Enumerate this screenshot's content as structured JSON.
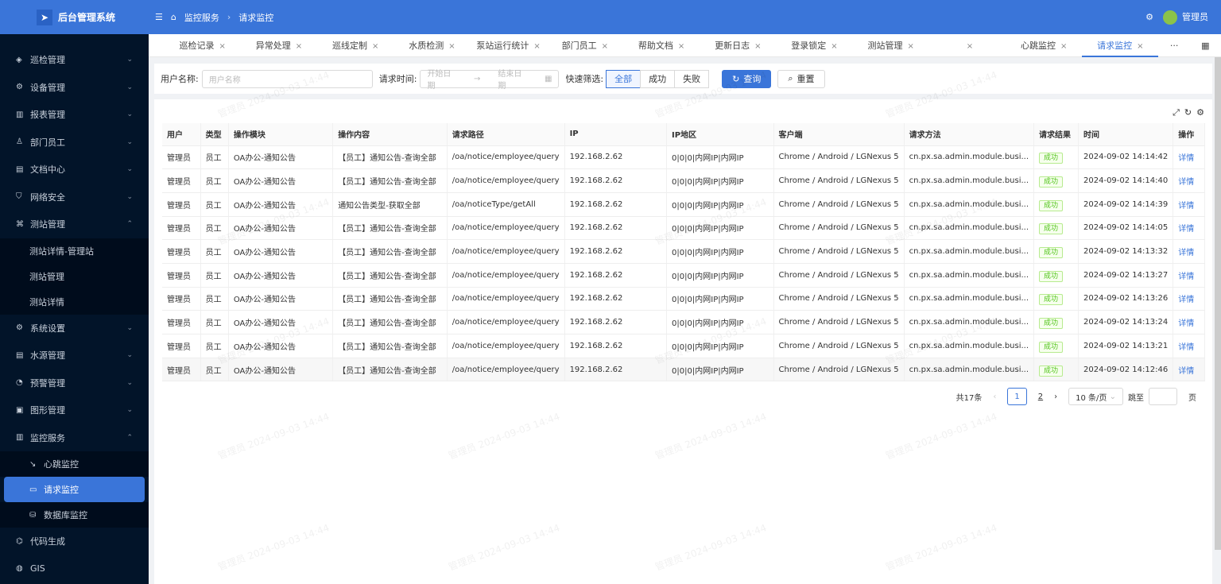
{
  "app": {
    "title": "后台管理系统",
    "user": "管理员"
  },
  "breadcrumb": [
    "监控服务",
    "请求监控"
  ],
  "sidebar": {
    "items": [
      {
        "label": "巡检管理",
        "icon": "target-icon",
        "chev": "⌄"
      },
      {
        "label": "设备管理",
        "icon": "gear-icon",
        "chev": "⌄"
      },
      {
        "label": "报表管理",
        "icon": "chart-icon",
        "chev": "⌄"
      },
      {
        "label": "部门员工",
        "icon": "user-icon",
        "chev": "⌄"
      },
      {
        "label": "文档中心",
        "icon": "doc-icon",
        "chev": "⌄"
      },
      {
        "label": "网络安全",
        "icon": "shield-icon",
        "chev": "⌄"
      },
      {
        "label": "测站管理",
        "icon": "network-icon",
        "chev": "⌃"
      }
    ],
    "station_sub": [
      "测站详情-管理站",
      "测站管理",
      "测站详情"
    ],
    "items2": [
      {
        "label": "系统设置",
        "icon": "gear-icon",
        "chev": "⌄"
      },
      {
        "label": "水源管理",
        "icon": "doc-icon",
        "chev": "⌄"
      },
      {
        "label": "预警管理",
        "icon": "alert-icon",
        "chev": "⌄"
      },
      {
        "label": "图形管理",
        "icon": "shape-icon",
        "chev": "⌄"
      },
      {
        "label": "监控服务",
        "icon": "chart-icon",
        "chev": "⌃"
      }
    ],
    "monitor_sub": [
      "心跳监控",
      "请求监控",
      "数据库监控"
    ],
    "items3": [
      {
        "label": "代码生成",
        "icon": "code-icon"
      },
      {
        "label": "GIS",
        "icon": "globe-icon"
      }
    ]
  },
  "tabs": [
    "巡检记录",
    "异常处理",
    "巡线定制",
    "水质检测",
    "泵站运行统计",
    "部门员工",
    "帮助文档",
    "更新日志",
    "登录锁定",
    "测站管理",
    "",
    "心跳监控",
    "请求监控"
  ],
  "active_tab": "请求监控",
  "filter": {
    "user_label": "用户名称:",
    "user_placeholder": "用户名称",
    "time_label": "请求时间:",
    "start_placeholder": "开始日期",
    "end_placeholder": "结束日期",
    "quick_label": "快速筛选:",
    "quick_options": [
      "全部",
      "成功",
      "失败"
    ],
    "quick_selected": "全部",
    "query": "查询",
    "reset": "重置"
  },
  "table": {
    "columns": [
      "用户",
      "类型",
      "操作模块",
      "操作内容",
      "请求路径",
      "IP",
      "IP地区",
      "客户端",
      "请求方法",
      "请求结果",
      "时间",
      "操作"
    ],
    "rows": [
      [
        "管理员",
        "员工",
        "OA办公-通知公告",
        "【员工】通知公告-查询全部",
        "/oa/notice/employee/query",
        "192.168.2.62",
        "0|0|0|内网IP|内网IP",
        "Chrome / Android / LGNexus 5",
        "cn.px.sa.admin.module.busi...",
        "成功",
        "2024-09-02 14:14:42",
        "详情"
      ],
      [
        "管理员",
        "员工",
        "OA办公-通知公告",
        "【员工】通知公告-查询全部",
        "/oa/notice/employee/query",
        "192.168.2.62",
        "0|0|0|内网IP|内网IP",
        "Chrome / Android / LGNexus 5",
        "cn.px.sa.admin.module.busi...",
        "成功",
        "2024-09-02 14:14:40",
        "详情"
      ],
      [
        "管理员",
        "员工",
        "OA办公-通知公告",
        "通知公告类型-获取全部",
        "/oa/noticeType/getAll",
        "192.168.2.62",
        "0|0|0|内网IP|内网IP",
        "Chrome / Android / LGNexus 5",
        "cn.px.sa.admin.module.busi...",
        "成功",
        "2024-09-02 14:14:39",
        "详情"
      ],
      [
        "管理员",
        "员工",
        "OA办公-通知公告",
        "【员工】通知公告-查询全部",
        "/oa/notice/employee/query",
        "192.168.2.62",
        "0|0|0|内网IP|内网IP",
        "Chrome / Android / LGNexus 5",
        "cn.px.sa.admin.module.busi...",
        "成功",
        "2024-09-02 14:14:05",
        "详情"
      ],
      [
        "管理员",
        "员工",
        "OA办公-通知公告",
        "【员工】通知公告-查询全部",
        "/oa/notice/employee/query",
        "192.168.2.62",
        "0|0|0|内网IP|内网IP",
        "Chrome / Android / LGNexus 5",
        "cn.px.sa.admin.module.busi...",
        "成功",
        "2024-09-02 14:13:32",
        "详情"
      ],
      [
        "管理员",
        "员工",
        "OA办公-通知公告",
        "【员工】通知公告-查询全部",
        "/oa/notice/employee/query",
        "192.168.2.62",
        "0|0|0|内网IP|内网IP",
        "Chrome / Android / LGNexus 5",
        "cn.px.sa.admin.module.busi...",
        "成功",
        "2024-09-02 14:13:27",
        "详情"
      ],
      [
        "管理员",
        "员工",
        "OA办公-通知公告",
        "【员工】通知公告-查询全部",
        "/oa/notice/employee/query",
        "192.168.2.62",
        "0|0|0|内网IP|内网IP",
        "Chrome / Android / LGNexus 5",
        "cn.px.sa.admin.module.busi...",
        "成功",
        "2024-09-02 14:13:26",
        "详情"
      ],
      [
        "管理员",
        "员工",
        "OA办公-通知公告",
        "【员工】通知公告-查询全部",
        "/oa/notice/employee/query",
        "192.168.2.62",
        "0|0|0|内网IP|内网IP",
        "Chrome / Android / LGNexus 5",
        "cn.px.sa.admin.module.busi...",
        "成功",
        "2024-09-02 14:13:24",
        "详情"
      ],
      [
        "管理员",
        "员工",
        "OA办公-通知公告",
        "【员工】通知公告-查询全部",
        "/oa/notice/employee/query",
        "192.168.2.62",
        "0|0|0|内网IP|内网IP",
        "Chrome / Android / LGNexus 5",
        "cn.px.sa.admin.module.busi...",
        "成功",
        "2024-09-02 14:13:21",
        "详情"
      ],
      [
        "管理员",
        "员工",
        "OA办公-通知公告",
        "【员工】通知公告-查询全部",
        "/oa/notice/employee/query",
        "192.168.2.62",
        "0|0|0|内网IP|内网IP",
        "Chrome / Android / LGNexus 5",
        "cn.px.sa.admin.module.busi...",
        "成功",
        "2024-09-02 14:12:46",
        "详情"
      ]
    ]
  },
  "pager": {
    "total": "共17条",
    "pages": [
      "1",
      "2"
    ],
    "current": "1",
    "page_size": "10 条/页",
    "jump_label": "跳至",
    "page_unit": "页"
  },
  "watermark": "管理员 2024-09-03 14:44",
  "colors": {
    "primary": "#3a75d9",
    "sidebar": "#021429",
    "success": "#52c41a"
  }
}
